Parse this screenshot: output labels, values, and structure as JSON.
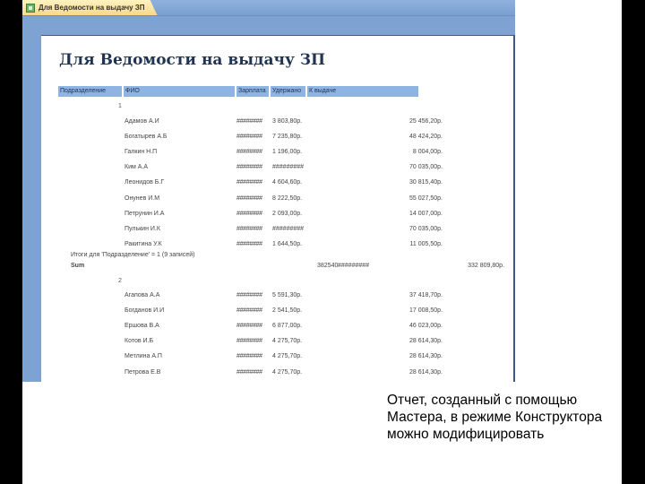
{
  "window": {
    "tab_title": "Для Ведомости на выдачу ЗП"
  },
  "report": {
    "title": "Для Ведомости на выдачу ЗП",
    "columns": [
      "Подразделение",
      "ФИО",
      "Зарплата",
      "Удержано",
      "К выдаче"
    ],
    "groups": [
      {
        "id": "1",
        "rows": [
          {
            "name": "Адамов А.И",
            "salary": "########",
            "deducted": "3 803,80р.",
            "payout": "25 456,20р."
          },
          {
            "name": "Богатырев А.Б",
            "salary": "########",
            "deducted": "7 235,80р.",
            "payout": "48 424,20р."
          },
          {
            "name": "Галкин Н.П",
            "salary": "########",
            "deducted": "1 196,00р.",
            "payout": "8 004,00р."
          },
          {
            "name": "Ким А.А",
            "salary": "########",
            "deducted": "#########",
            "payout": "70 035,00р."
          },
          {
            "name": "Леонидов Б.Г",
            "salary": "########",
            "deducted": "4 604,60р.",
            "payout": "30 815,40р."
          },
          {
            "name": "Онунев И.М",
            "salary": "########",
            "deducted": "8 222,50р.",
            "payout": "55 027,50р."
          },
          {
            "name": "Петрунин И.А",
            "salary": "########",
            "deducted": "2 093,00р.",
            "payout": "14 007,00р."
          },
          {
            "name": "Пулькин И.К",
            "salary": "########",
            "deducted": "#########",
            "payout": "70 035,00р."
          },
          {
            "name": "Ракитина У.К",
            "salary": "########",
            "deducted": "1 644,50р.",
            "payout": "11 005,50р."
          }
        ],
        "totals_label": "Итоги для 'Подразделение' = 1 (9 записей)",
        "sum_label": "Sum",
        "sum_salary": "382540",
        "sum_deducted": "#########",
        "sum_payout": "332 809,80р."
      },
      {
        "id": "2",
        "rows": [
          {
            "name": "Агапова А.А",
            "salary": "########",
            "deducted": "5 591,30р.",
            "payout": "37 418,70р."
          },
          {
            "name": "Богданов И.И",
            "salary": "########",
            "deducted": "2 541,50р.",
            "payout": "17 008,50р."
          },
          {
            "name": "Ершова В.А",
            "salary": "########",
            "deducted": "6 877,00р.",
            "payout": "46 023,00р."
          },
          {
            "name": "Котов И.Б",
            "salary": "########",
            "deducted": "4 275,70р.",
            "payout": "28 614,30р."
          },
          {
            "name": "Метлина А.П",
            "salary": "########",
            "deducted": "4 275,70р.",
            "payout": "28 614,30р."
          },
          {
            "name": "Петрова Е.В",
            "salary": "########",
            "deducted": "4 275,70р.",
            "payout": "28 614,30р."
          }
        ]
      }
    ]
  },
  "caption": "Отчет, созданный с помощью Мастера, в режиме Конструктора можно модифицировать"
}
